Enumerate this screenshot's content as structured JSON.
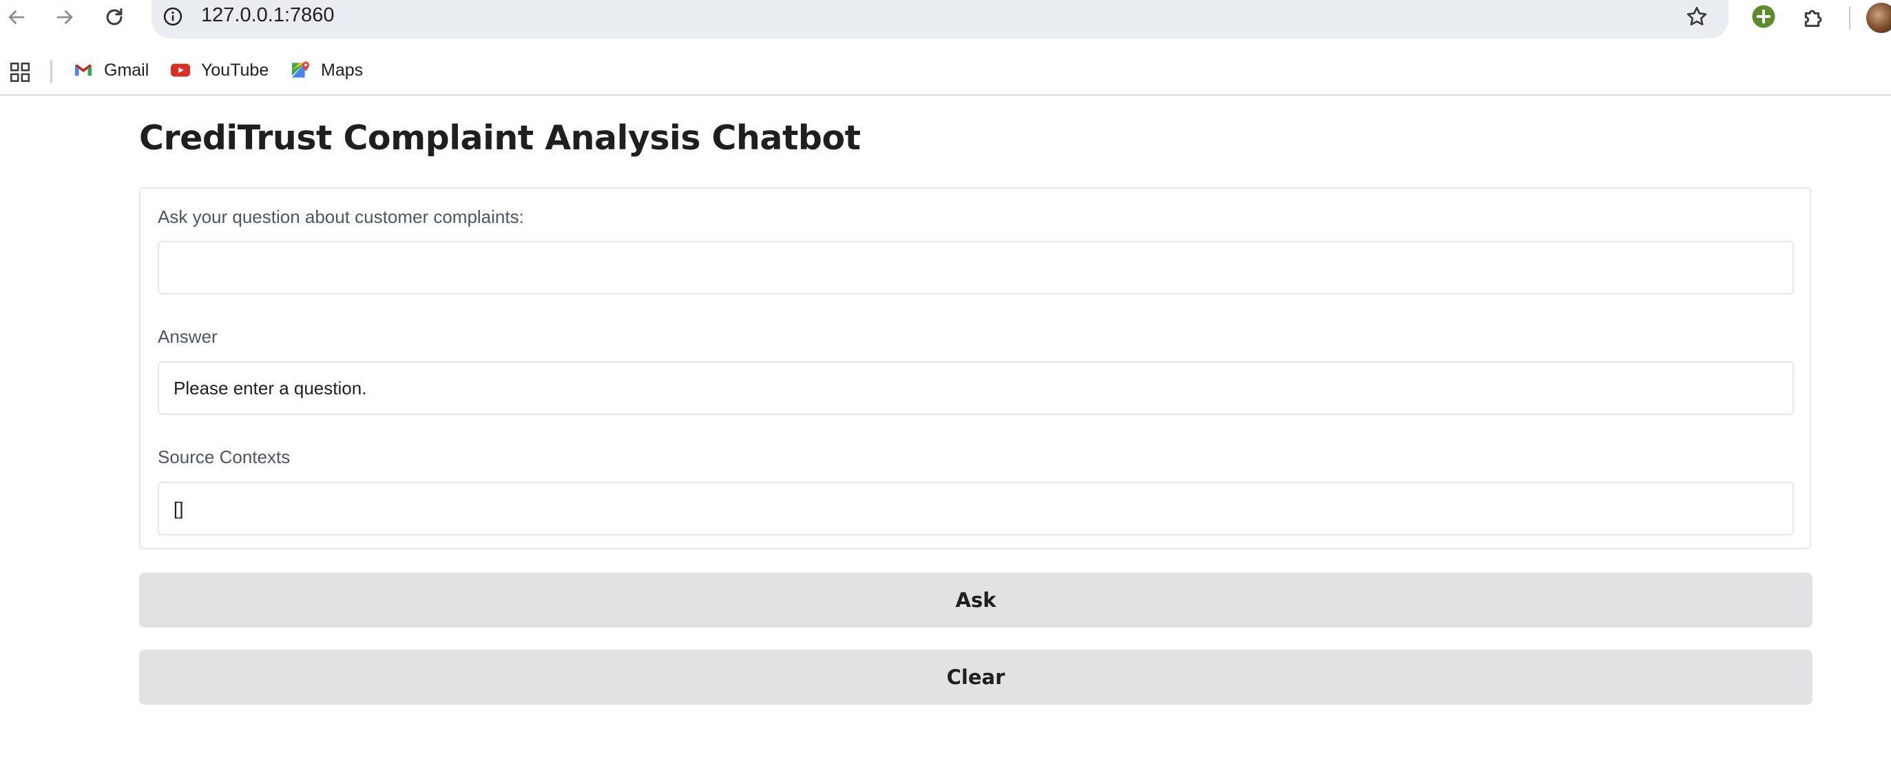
{
  "browser": {
    "url": "127.0.0.1:7860",
    "bookmarks": [
      {
        "label": "Gmail",
        "icon": "gmail-icon"
      },
      {
        "label": "YouTube",
        "icon": "youtube-icon"
      },
      {
        "label": "Maps",
        "icon": "maps-icon"
      }
    ]
  },
  "app": {
    "title": "CrediTrust Complaint Analysis Chatbot",
    "question": {
      "label": "Ask your question about customer complaints:",
      "value": "",
      "placeholder": ""
    },
    "answer": {
      "label": "Answer",
      "value": "Please enter a question."
    },
    "sources": {
      "label": "Source Contexts",
      "value": "[]"
    },
    "ask_button": "Ask",
    "clear_button": "Clear"
  },
  "colors": {
    "button_bg": "#e2e2e5",
    "border": "#e5e7eb",
    "label_text": "#4b5563",
    "omnibox_bg": "#e9ecf1"
  }
}
